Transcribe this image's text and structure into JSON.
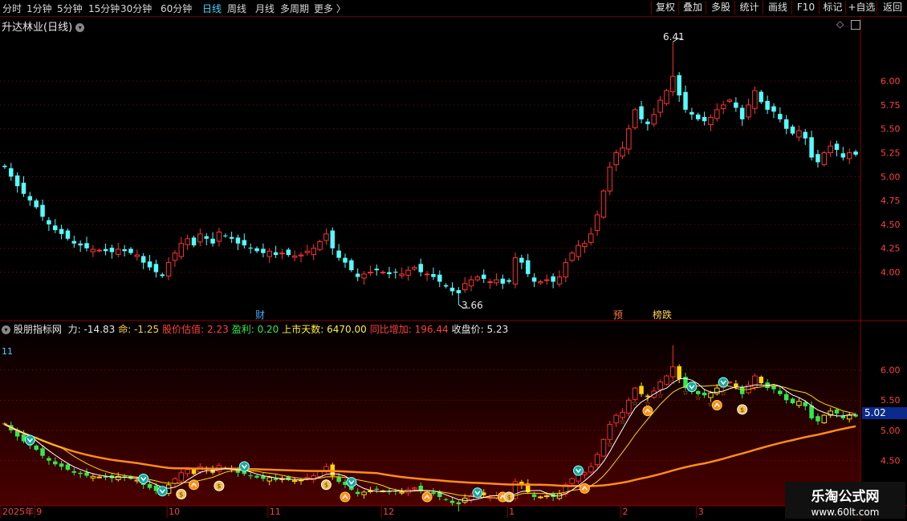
{
  "toolbar": {
    "left": [
      "分时",
      "1分钟",
      "5分钟",
      "15分钟",
      "30分钟",
      "60分钟",
      "日线",
      "周线",
      "月线",
      "多周期",
      "更多 〉"
    ],
    "active": "日线",
    "right": [
      "复权",
      "叠加",
      "多股",
      "统计",
      "画线",
      "F10",
      "标记",
      "+自选",
      "返回"
    ]
  },
  "main_panel": {
    "title": "升达林业(日线)",
    "high_label": "6.41",
    "low_label": "3.66",
    "event_tags": [
      "财",
      "预",
      "榜跌"
    ]
  },
  "indicator": {
    "name": "股朋指标网",
    "fields": [
      {
        "label": "力:",
        "value": "-14.83",
        "color": "#e8e8e8"
      },
      {
        "label": "命:",
        "value": "-1.25",
        "color": "#ffd24a"
      },
      {
        "label": "股价估值:",
        "value": "2.23",
        "color": "#ff4040"
      },
      {
        "label": "盈利:",
        "value": "0.20",
        "color": "#33e84a"
      },
      {
        "label": "上市天数:",
        "value": "6470.00",
        "color": "#ffee33"
      },
      {
        "label": "同比增加:",
        "value": "196.44",
        "color": "#ff4040"
      },
      {
        "label": "收盘价:",
        "value": "5.23",
        "color": "#e8e8e8"
      }
    ],
    "corner_value": "11",
    "current_marker": "5.02"
  },
  "x_axis": {
    "labels": [
      {
        "text": "2025年",
        "i": 0
      },
      {
        "text": "9",
        "i": 5
      },
      {
        "text": "10",
        "i": 26
      },
      {
        "text": "11",
        "i": 42
      },
      {
        "text": "12",
        "i": 60
      },
      {
        "text": "1",
        "i": 80
      },
      {
        "text": "2",
        "i": 98
      },
      {
        "text": "3",
        "i": 110
      }
    ]
  },
  "watermark": {
    "line1": "乐淘公式网",
    "line2": "www.60lt.com"
  },
  "colors": {
    "up": "#ff3333",
    "down": "#54ffff",
    "ma5": "#ffffff",
    "ma10": "#ffd700",
    "ma60": "#ff8c1a",
    "grid": "#8b0000"
  },
  "chart_data": {
    "type": "candlestick",
    "y_ticks_main": [
      4.0,
      4.25,
      4.5,
      4.75,
      5.0,
      5.25,
      5.5,
      5.75,
      6.0
    ],
    "y_ticks_sub": [
      4.5,
      5.0,
      5.5,
      6.0
    ],
    "ylim_main": [
      3.56,
      6.58
    ],
    "ylim_sub": [
      3.9,
      6.55
    ],
    "close": [
      5.1,
      5.0,
      4.9,
      4.82,
      4.75,
      4.68,
      4.58,
      4.5,
      4.44,
      4.4,
      4.35,
      4.3,
      4.28,
      4.25,
      4.24,
      4.23,
      4.22,
      4.21,
      4.24,
      4.22,
      4.2,
      4.18,
      4.1,
      4.05,
      4.0,
      3.96,
      4.1,
      4.2,
      4.3,
      4.35,
      4.28,
      4.4,
      4.35,
      4.3,
      4.42,
      4.38,
      4.35,
      4.3,
      4.28,
      4.25,
      4.22,
      4.2,
      4.22,
      4.18,
      4.2,
      4.18,
      4.17,
      4.18,
      4.22,
      4.25,
      4.32,
      4.4,
      4.25,
      4.15,
      4.1,
      4.02,
      3.95,
      3.98,
      4.0,
      4.02,
      4.0,
      3.98,
      4.0,
      3.98,
      4.02,
      4.05,
      4.0,
      3.98,
      3.95,
      3.9,
      3.85,
      3.8,
      3.78,
      3.88,
      3.92,
      3.95,
      3.93,
      3.9,
      3.92,
      3.88,
      3.9,
      4.15,
      4.1,
      3.98,
      3.9,
      3.9,
      3.92,
      3.9,
      3.95,
      4.1,
      4.2,
      4.28,
      4.3,
      4.4,
      4.6,
      4.85,
      5.1,
      5.25,
      5.3,
      5.5,
      5.7,
      5.6,
      5.55,
      5.65,
      5.8,
      5.9,
      6.05,
      5.85,
      5.7,
      5.65,
      5.6,
      5.58,
      5.62,
      5.7,
      5.75,
      5.8,
      5.72,
      5.6,
      5.75,
      5.9,
      5.78,
      5.7,
      5.68,
      5.6,
      5.5,
      5.45,
      5.48,
      5.4,
      5.2,
      5.15,
      5.25,
      5.32,
      5.28,
      5.2,
      5.25,
      5.23
    ]
  }
}
